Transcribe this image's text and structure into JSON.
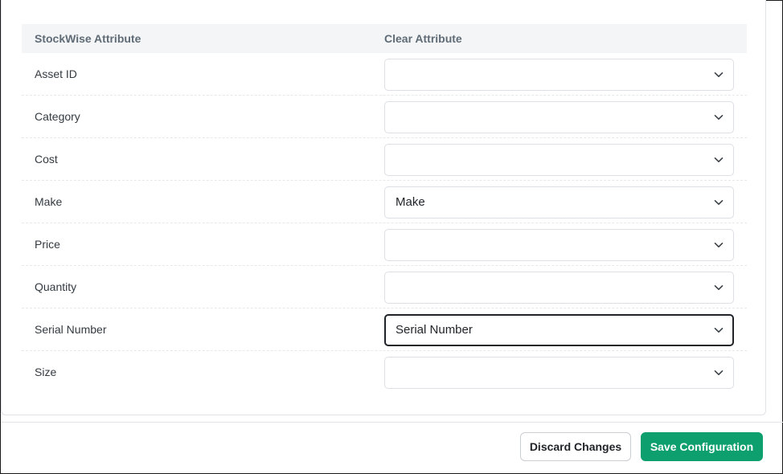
{
  "table": {
    "headers": {
      "attribute": "StockWise Attribute",
      "clear": "Clear Attribute"
    },
    "rows": [
      {
        "label": "Asset ID",
        "value": ""
      },
      {
        "label": "Category",
        "value": ""
      },
      {
        "label": "Cost",
        "value": ""
      },
      {
        "label": "Make",
        "value": "Make"
      },
      {
        "label": "Price",
        "value": ""
      },
      {
        "label": "Quantity",
        "value": ""
      },
      {
        "label": "Serial Number",
        "value": "Serial Number"
      },
      {
        "label": "Size",
        "value": ""
      }
    ],
    "focused_row": "Serial Number"
  },
  "footer": {
    "discard_label": "Discard Changes",
    "save_label": "Save Configuration"
  },
  "colors": {
    "primary": "#0e9f6e",
    "header_bg": "#f4f5f6",
    "header_text": "#5f6b76"
  },
  "icons": {
    "dropdown": "chevron-down-icon"
  }
}
